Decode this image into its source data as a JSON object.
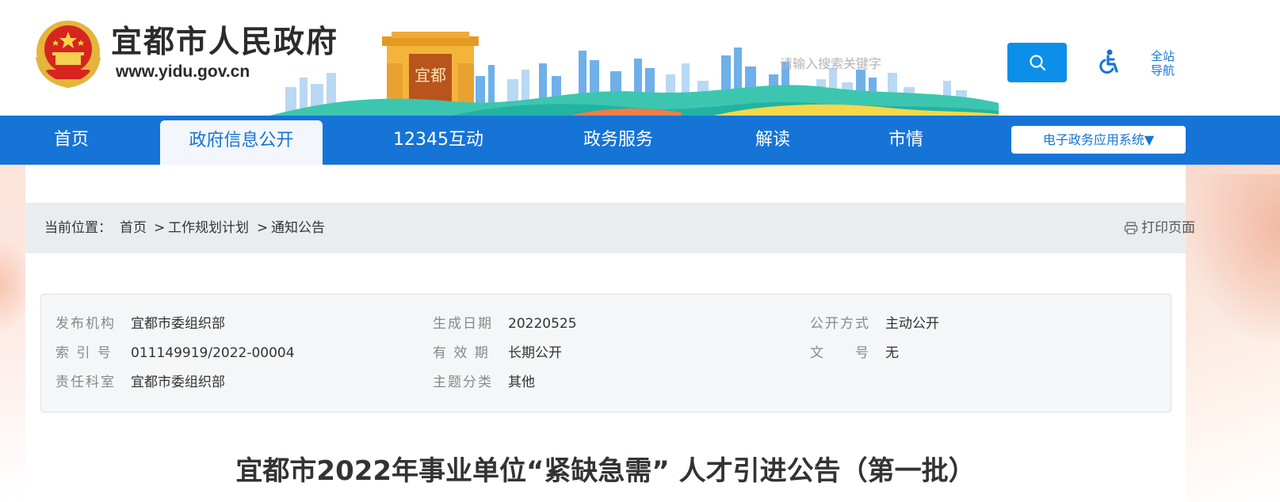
{
  "header": {
    "site_name": "宜都市人民政府",
    "site_url": "www.yidu.gov.cn",
    "skyline_sign": "宜都",
    "search": {
      "placeholder": "请输入搜索关键字",
      "value": "",
      "button_icon": "search-icon"
    },
    "accessibility_icon": "wheelchair-icon",
    "site_nav_label": "全站导航"
  },
  "nav": {
    "items": [
      {
        "label": "首页",
        "active": false
      },
      {
        "label": "政府信息公开",
        "active": true
      },
      {
        "label": "12345互动",
        "active": false
      },
      {
        "label": "政务服务",
        "active": false
      },
      {
        "label": "解读",
        "active": false
      },
      {
        "label": "市情",
        "active": false
      }
    ],
    "dropdown_label": "电子政务应用系统▼"
  },
  "breadcrumb": {
    "prefix": "当前位置：",
    "items": [
      "首页",
      "工作规划计划",
      "通知公告"
    ],
    "separator": ">",
    "print_label": "打印页面"
  },
  "meta": {
    "publisher_label": "发布机构",
    "publisher": "宜都市委组织部",
    "index_label": "索 引 号",
    "index": "011149919/2022-00004",
    "dept_label": "责任科室",
    "dept": "宜都市委组织部",
    "date_label": "生成日期",
    "date": "20220525",
    "validity_label": "有 效 期",
    "validity": "长期公开",
    "category_label": "主题分类",
    "category": "其他",
    "disclosure_label": "公开方式",
    "disclosure": "主动公开",
    "docno_label": "文　　号",
    "docno": "无"
  },
  "article": {
    "title": "宜都市2022年事业单位“紧缺急需” 人才引进公告（第一批）"
  },
  "colors": {
    "nav_blue": "#1674d6",
    "search_blue": "#0b8fe8",
    "breadcrumb_bg": "#eaedf0",
    "meta_bg": "#f5f6f7"
  }
}
